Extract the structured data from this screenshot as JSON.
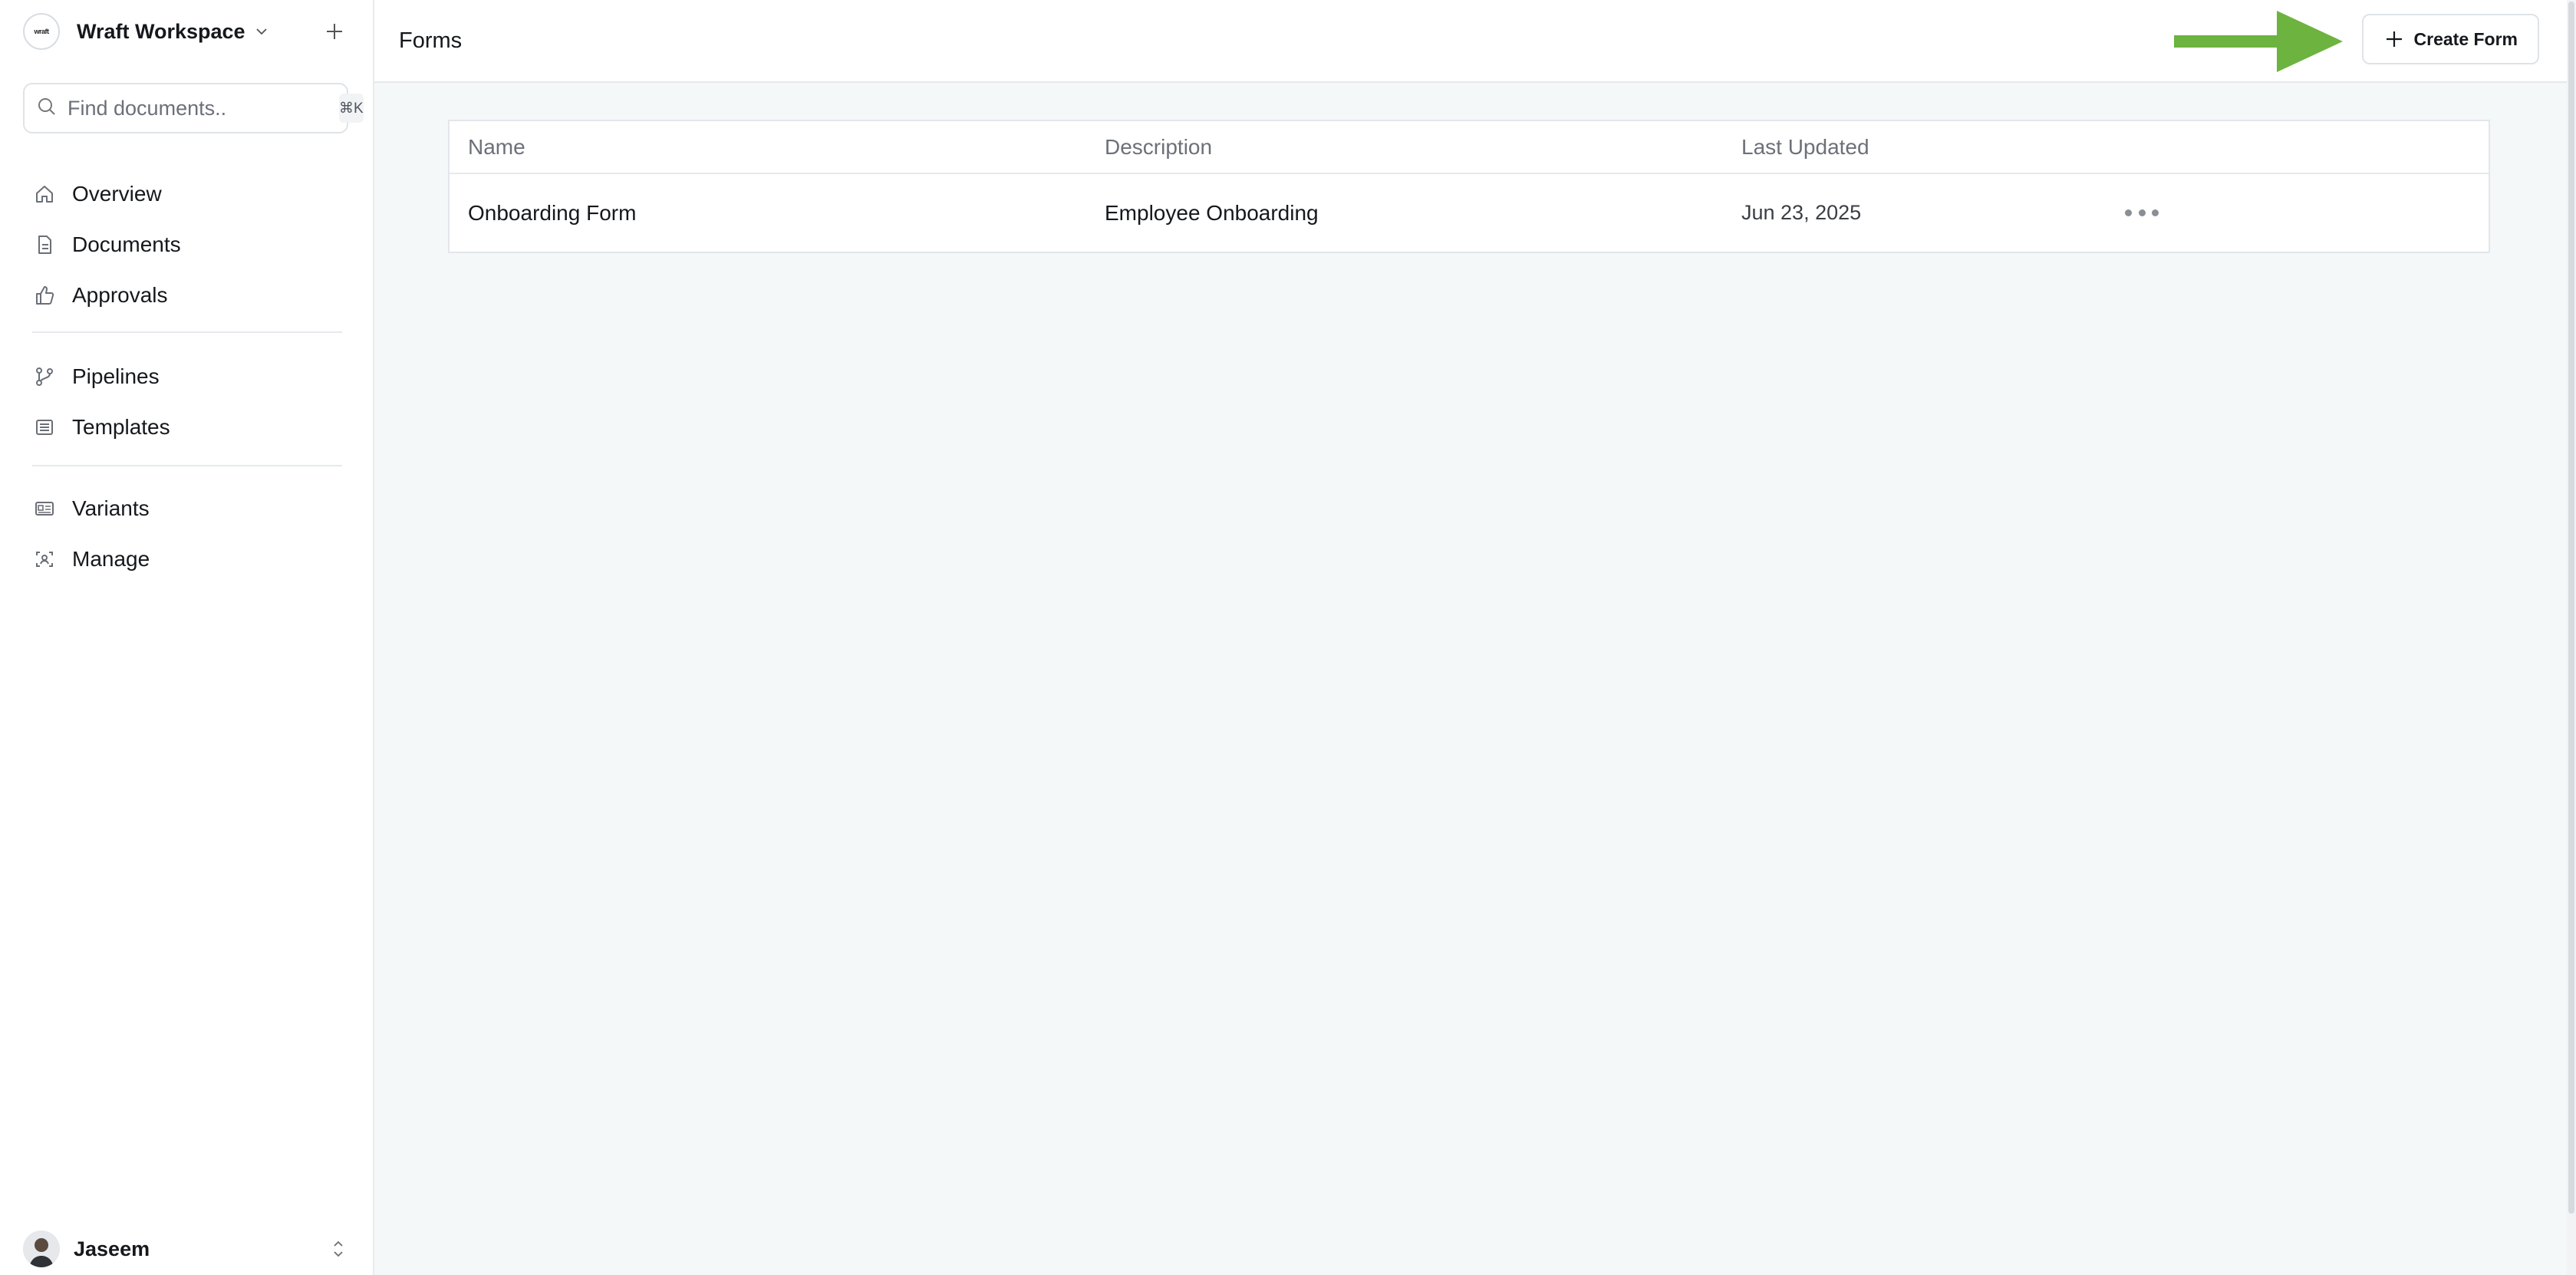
{
  "workspace": {
    "logo_text": "wraft",
    "name": "Wraft Workspace"
  },
  "search": {
    "placeholder": "Find documents..",
    "shortcut": "⌘K"
  },
  "nav": {
    "group1": [
      {
        "label": "Overview",
        "icon": "home-icon"
      },
      {
        "label": "Documents",
        "icon": "document-icon"
      },
      {
        "label": "Approvals",
        "icon": "thumbs-up-icon"
      }
    ],
    "group2": [
      {
        "label": "Pipelines",
        "icon": "git-branch-icon"
      },
      {
        "label": "Templates",
        "icon": "list-icon"
      }
    ],
    "group3": [
      {
        "label": "Variants",
        "icon": "id-card-icon"
      },
      {
        "label": "Manage",
        "icon": "user-scan-icon"
      }
    ]
  },
  "user": {
    "name": "Jaseem"
  },
  "header": {
    "title": "Forms",
    "create_label": "Create Form",
    "arrow_color": "#6db33f"
  },
  "table": {
    "columns": [
      "Name",
      "Description",
      "Last Updated"
    ],
    "rows": [
      {
        "name": "Onboarding Form",
        "description": "Employee Onboarding",
        "updated": "Jun 23, 2025"
      }
    ]
  }
}
